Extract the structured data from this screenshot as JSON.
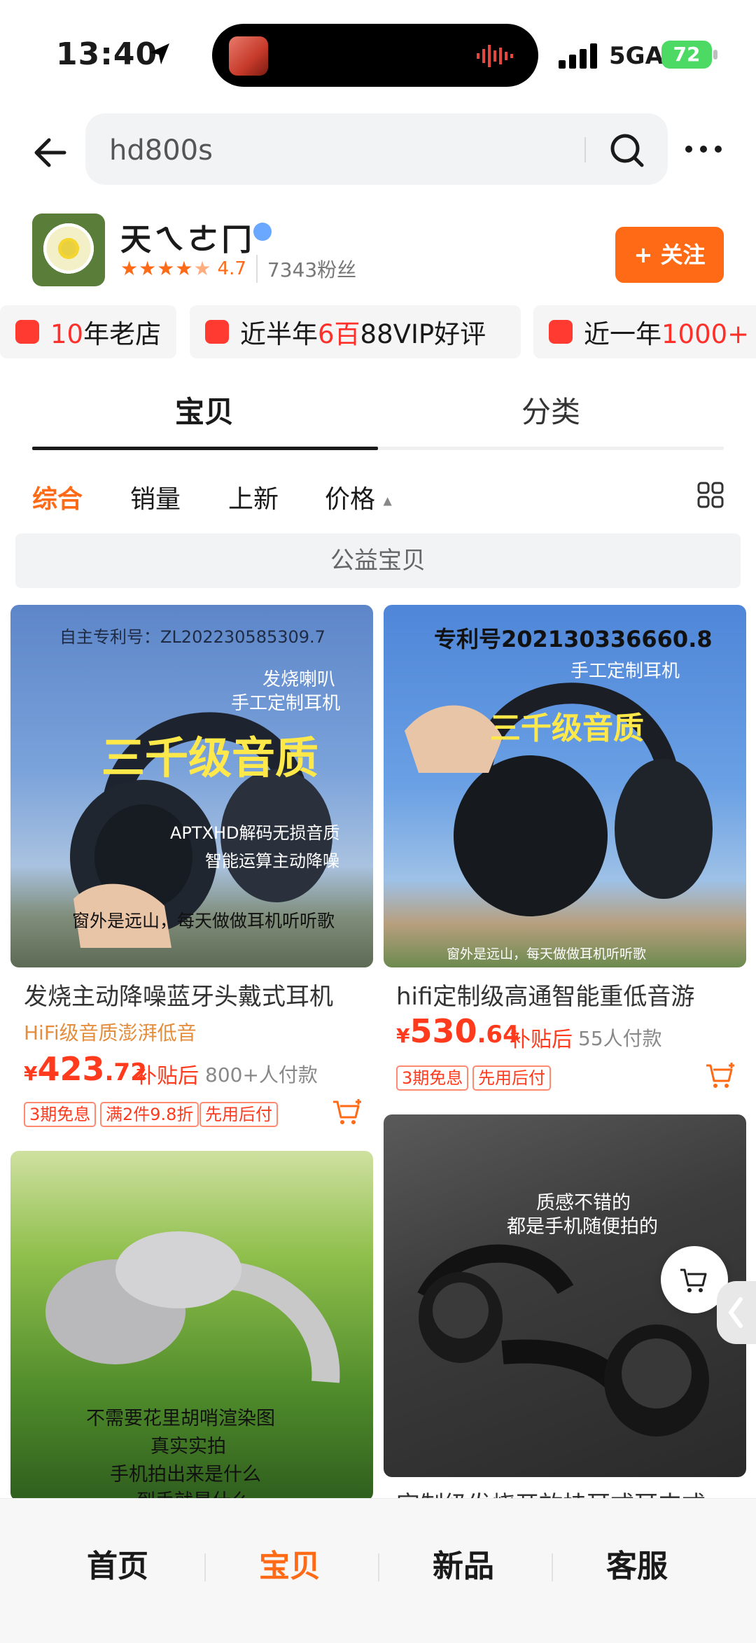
{
  "status_bar": {
    "time": "13:40",
    "network": "5GA",
    "battery": "72"
  },
  "search": {
    "query": "hd800s"
  },
  "shop": {
    "name": "天ㄟㄜ冂",
    "rating": "4.7",
    "fans": "7343粉丝",
    "follow_label": "+ 关注",
    "badges": [
      {
        "prefix": "",
        "highlight": "10",
        "suffix": "年老店"
      },
      {
        "prefix": "近半年",
        "highlight": "6百",
        "suffix": "88VIP好评"
      },
      {
        "prefix": "近一年",
        "highlight": "1000+",
        "suffix": ""
      }
    ]
  },
  "tabs": [
    "宝贝",
    "分类"
  ],
  "sort": [
    "综合",
    "销量",
    "上新",
    "价格"
  ],
  "gongyi": "公益宝贝",
  "products": [
    {
      "title": "发烧主动降噪蓝牙头戴式耳机",
      "subtitle": "HiFi级音质澎湃低音",
      "price_cur": "¥",
      "price_int": "423",
      "price_dec": ".72",
      "subsidy": "补贴后",
      "paid": "800+人付款",
      "tags": [
        "3期免息",
        "满2件9.8折",
        "先用后付"
      ],
      "image_text": [
        "自主专利号：ZL202230585309.7",
        "发烧喇叭",
        "手工定制耳机",
        "三千级音质",
        "APTXHD解码无损音质",
        "智能运算主动降噪",
        "窗外是远山，每天做做耳机听听歌"
      ]
    },
    {
      "title": "hifi定制级高通智能重低音游",
      "price_cur": "¥",
      "price_int": "530",
      "price_dec": ".64",
      "subsidy": "补贴后",
      "paid": "55人付款",
      "tags": [
        "3期免息",
        "先用后付"
      ],
      "image_text": [
        "专利号202130336660.8",
        "手工定制耳机",
        "三千级音质",
        "窗外是远山，每天做做耳机听听歌"
      ]
    },
    {
      "title": "",
      "image_text": [
        "不需要花里胡哨渲染图",
        "真实实拍",
        "手机拍出来是什么",
        "到手就是什么"
      ]
    },
    {
      "title": "定制级发烧开放挂耳式耳夹式",
      "image_text": [
        "质感不错的",
        "都是手机随便拍的"
      ]
    }
  ],
  "bottom_nav": [
    "首页",
    "宝贝",
    "新品",
    "客服"
  ],
  "colors": {
    "accent": "#ff6a17",
    "price": "#ff3a1d",
    "follow_bg": "#ff6a17"
  }
}
